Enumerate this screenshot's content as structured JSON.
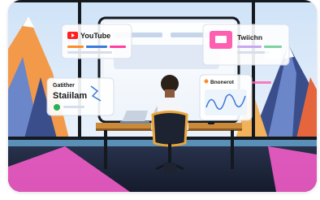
{
  "panels": {
    "youtube": {
      "label": "YouTube"
    },
    "twitch": {
      "label": "Twiichn"
    },
    "stream": {
      "line1": "Gatither",
      "line2": "Staiilam"
    },
    "analytics": {
      "label": "Bnonerot"
    }
  },
  "colors": {
    "background_pink": "#ff5fd0",
    "floor_blue": "#1e2a44",
    "window_frame": "#14181f",
    "youtube_red": "#ff1f1f",
    "twitch_pink": "#ff5fb0",
    "desk_wood": "#c98a3a"
  }
}
